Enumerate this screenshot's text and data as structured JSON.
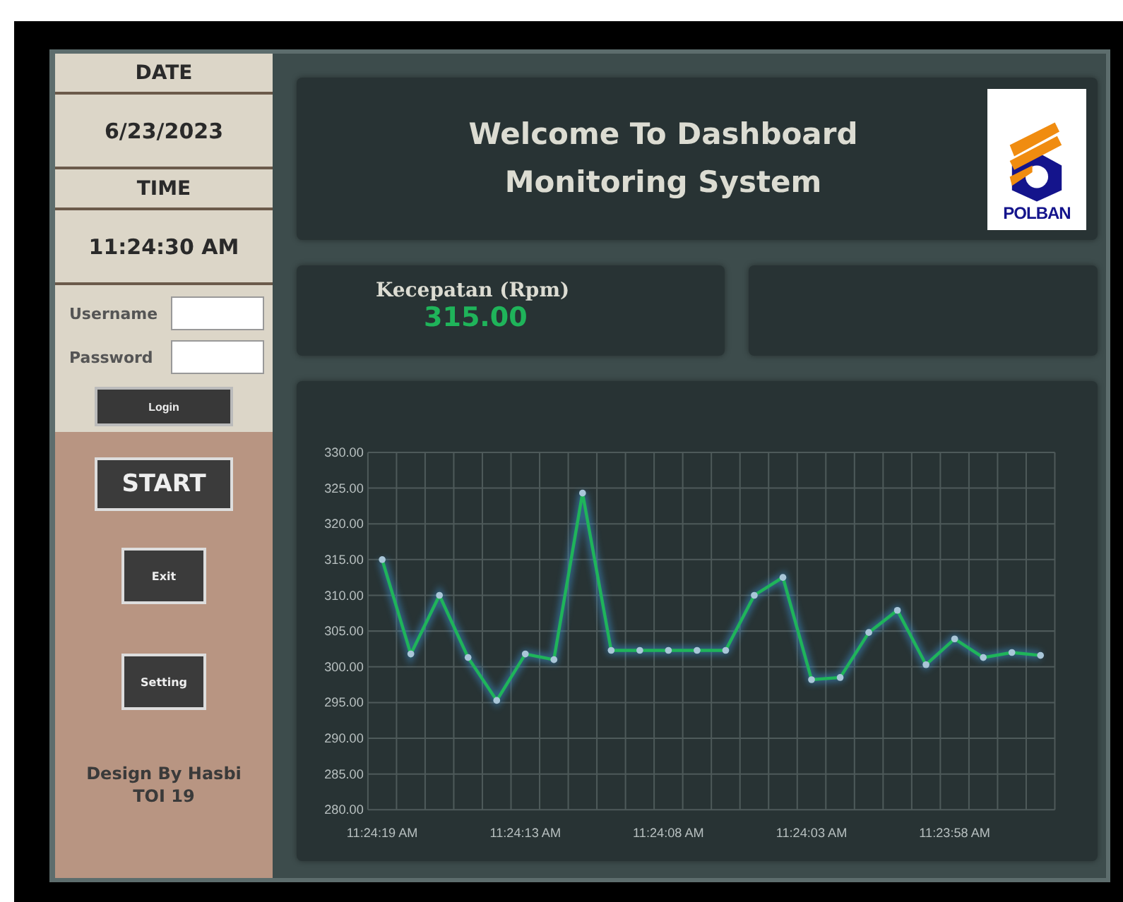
{
  "sidebar": {
    "date_label": "DATE",
    "date": "6/23/2023",
    "time_label": "TIME",
    "time": "11:24:30 AM",
    "login": {
      "username_label": "Username",
      "password_label": "Password",
      "button": "Login"
    },
    "buttons": [
      {
        "label": "START",
        "kind": "large"
      },
      {
        "label": "Exit",
        "kind": "small"
      },
      {
        "label": "Setting",
        "kind": "small"
      }
    ],
    "credit": [
      "Design By Hasbi",
      "TOI 19"
    ]
  },
  "header": {
    "title_lines": [
      "Welcome To Dashboard",
      "Monitoring System"
    ],
    "logo_text": "POLBAN"
  },
  "metric": {
    "label": "Kecepatan (Rpm)",
    "value": "315.00"
  },
  "chart": {
    "chart_data": {
      "type": "line",
      "categories": [
        "11:24:19 AM",
        null,
        null,
        null,
        null,
        "11:24:13 AM",
        null,
        null,
        null,
        null,
        "11:24:08 AM",
        null,
        null,
        null,
        null,
        "11:24:03 AM",
        null,
        null,
        null,
        null,
        "11:23:58 AM",
        null,
        null,
        null
      ],
      "grid": true,
      "series": [
        {
          "color": "#1fb45a",
          "marker": true,
          "values": [
            315,
            301.8,
            310,
            301.3,
            295.3,
            301.8,
            301,
            324.3,
            302.3,
            302.3,
            302.3,
            302.3,
            302.3,
            310,
            312.5,
            298.2,
            298.5,
            304.8,
            307.9,
            300.3,
            303.9,
            301.3,
            302,
            301.6
          ]
        }
      ],
      "ylim": [
        280,
        330
      ],
      "yticks": [
        {
          "value": 280,
          "label": "280.00"
        },
        {
          "value": 285,
          "label": "285.00"
        },
        {
          "value": 290,
          "label": "290.00"
        },
        {
          "value": 295,
          "label": "295.00"
        },
        {
          "value": 300,
          "label": "300.00"
        },
        {
          "value": 305,
          "label": "305.00"
        },
        {
          "value": 310,
          "label": "310.00"
        },
        {
          "value": 315,
          "label": "315.00"
        },
        {
          "value": 320,
          "label": "320.00"
        },
        {
          "value": 325,
          "label": "325.00"
        },
        {
          "value": 330,
          "label": "330.00"
        }
      ]
    }
  }
}
